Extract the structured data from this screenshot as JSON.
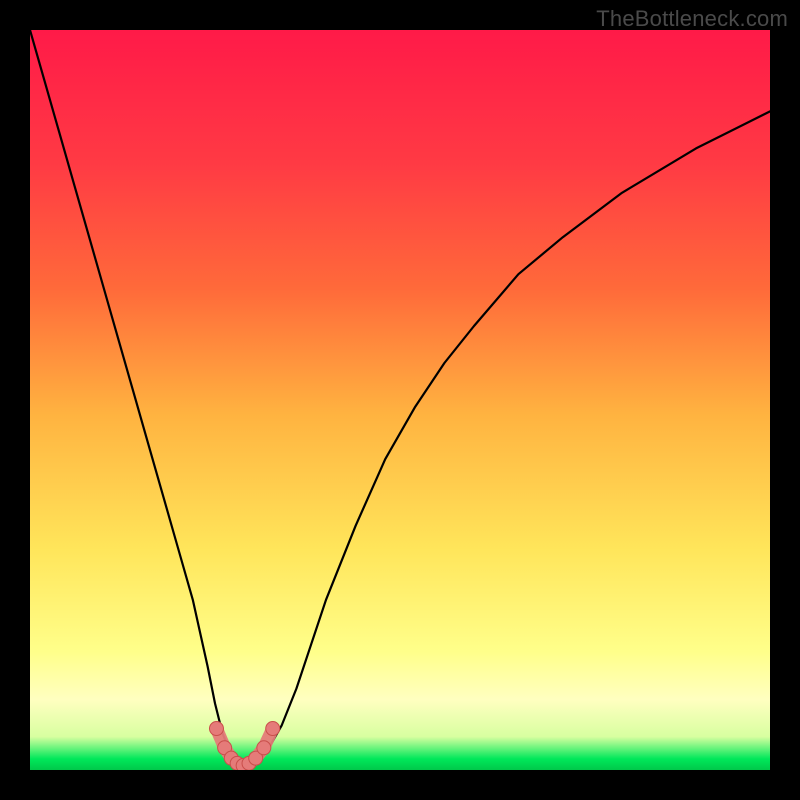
{
  "watermark": "TheBottleneck.com",
  "colors": {
    "bg": "#000000",
    "grad_top": "#ff1a48",
    "grad_mid_upper": "#ff6a3a",
    "grad_mid": "#ffb340",
    "grad_mid_lower": "#ffe55a",
    "grad_low": "#ffff8a",
    "grad_band": "#ffffc0",
    "grad_green": "#00e85a",
    "curve": "#000000",
    "dot_fill": "#e57b79",
    "dot_stroke": "#c94f4b"
  },
  "chart_data": {
    "type": "line",
    "title": "",
    "xlabel": "",
    "ylabel": "",
    "xlim": [
      0,
      100
    ],
    "ylim": [
      0,
      100
    ],
    "series": [
      {
        "name": "bottleneck-curve",
        "x": [
          0,
          2,
          4,
          6,
          8,
          10,
          12,
          14,
          16,
          18,
          20,
          22,
          24,
          25,
          26,
          27,
          28,
          29,
          30,
          31,
          32,
          34,
          36,
          38,
          40,
          44,
          48,
          52,
          56,
          60,
          66,
          72,
          80,
          90,
          100
        ],
        "y": [
          100,
          93,
          86,
          79,
          72,
          65,
          58,
          51,
          44,
          37,
          30,
          23,
          14,
          9,
          5,
          2.5,
          1.2,
          0.5,
          0.5,
          1.2,
          2.5,
          6,
          11,
          17,
          23,
          33,
          42,
          49,
          55,
          60,
          67,
          72,
          78,
          84,
          89
        ]
      }
    ],
    "dots": {
      "name": "valley-dots",
      "x": [
        25.2,
        26.3,
        27.2,
        28.0,
        28.8,
        29.6,
        30.5,
        31.6,
        32.8
      ],
      "y": [
        5.6,
        3.0,
        1.6,
        0.9,
        0.6,
        0.9,
        1.6,
        3.0,
        5.6
      ]
    }
  }
}
